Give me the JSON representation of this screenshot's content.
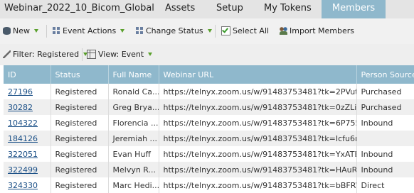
{
  "tabs": [
    {
      "label": "Webinar_2022_10_Bicom_Global",
      "active": false
    },
    {
      "label": "Assets",
      "active": false
    },
    {
      "label": "Setup",
      "active": false
    },
    {
      "label": "My Tokens",
      "active": false
    },
    {
      "label": "Members",
      "active": true
    }
  ],
  "toolbar": {
    "new_label": "New",
    "event_actions_label": "Event Actions",
    "change_status_label": "Change Status",
    "select_all_label": "Select All",
    "import_members_label": "Import Members"
  },
  "filters": {
    "filter_label": "Filter: Registered",
    "view_label": "View: Event"
  },
  "table": {
    "columns": [
      "ID",
      "Status",
      "Full Name",
      "Webinar URL",
      "Person Source"
    ],
    "rows": [
      {
        "id": "27196",
        "status": "Registered",
        "name": "Ronald Ca...",
        "url": "https://telnyx.zoom.us/w/91483753481?tk=2PVutZu...",
        "source": "Purchased"
      },
      {
        "id": "30282",
        "status": "Registered",
        "name": "Greg Brya...",
        "url": "https://telnyx.zoom.us/w/91483753481?tk=0zZLiwM...",
        "source": "Purchased"
      },
      {
        "id": "104322",
        "status": "Registered",
        "name": "Florencia ...",
        "url": "https://telnyx.zoom.us/w/91483753481?tk=6P755r...",
        "source": "Inbound"
      },
      {
        "id": "184126",
        "status": "Registered",
        "name": "Jeremiah ...",
        "url": "https://telnyx.zoom.us/w/91483753481?tk=Icfu6nTK...",
        "source": ""
      },
      {
        "id": "322051",
        "status": "Registered",
        "name": "Evan Huff",
        "url": "https://telnyx.zoom.us/w/91483753481?tk=YxATBrYi...",
        "source": "Inbound"
      },
      {
        "id": "322499",
        "status": "Registered",
        "name": "Melvyn R...",
        "url": "https://telnyx.zoom.us/w/91483753481?tk=HAuRIs4...",
        "source": "Inbound"
      },
      {
        "id": "324330",
        "status": "Registered",
        "name": "Marc Hedi...",
        "url": "https://telnyx.zoom.us/w/91483753481?tk=bBFRWI...",
        "source": "Direct"
      }
    ]
  }
}
